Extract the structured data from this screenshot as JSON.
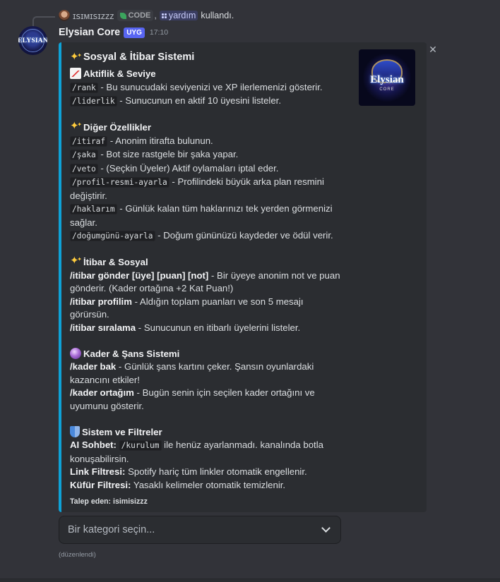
{
  "reply": {
    "user": "ɪꜱɪᴍɪꜱɪᴢᴢᴢ",
    "app_label": "CODE",
    "separator": ",",
    "command": "yardım",
    "action": "kullandı."
  },
  "message": {
    "bot_name": "Elysian Core",
    "bot_tag": "UYG",
    "time": "17:10",
    "avatar_text": "ELYSIAN"
  },
  "embed": {
    "accent_color": "#0ea2d7",
    "thumbnail": {
      "wordmark": "Elysian",
      "sub": "CORE"
    },
    "title": "Sosyal & İtibar Sistemi",
    "sections": {
      "s1": {
        "title": "Aktiflik & Seviye",
        "l1_cmd": "/rank",
        "l1_text": " - Bu sunucudaki seviyenizi ve XP ilerlemenizi gösterir.",
        "l2_cmd": "/liderlik",
        "l2_text": " - Sunucunun en aktif 10 üyesini listeler."
      },
      "s2": {
        "title": "Diğer Özellikler",
        "l1_cmd": "/itiraf",
        "l1_text": " - Anonim itirafta bulunun.",
        "l2_cmd": "/şaka",
        "l2_text": " - Bot size rastgele bir şaka yapar.",
        "l3_cmd": "/veto",
        "l3_text": " - (Seçkin Üyeler) Aktif oylamaları iptal eder.",
        "l4_cmd": "/profil-resmi-ayarla",
        "l4_text": " - Profilindeki büyük arka plan resmini",
        "l4_text2": "değiştirir.",
        "l5_cmd": "/haklarım",
        "l5_text": " - Günlük kalan tüm haklarınızı tek yerden görmenizi",
        "l5_text2": "sağlar.",
        "l6_cmd": "/doğumgünü-ayarla",
        "l6_text": " - Doğum gününüzü kaydeder ve ödül verir."
      },
      "s3": {
        "title": "İtibar & Sosyal",
        "l1_bold": "/itibar gönder [üye] [puan] [not]",
        "l1_text": " - Bir üyeye anonim not ve puan",
        "l1_text2": "gönderir. (Kader ortağına +2 Kat Puan!)",
        "l2_bold": "/itibar profilim",
        "l2_text": " - Aldığın toplam puanları ve son 5 mesajı",
        "l2_text2": "görürsün.",
        "l3_bold": "/itibar sıralama",
        "l3_text": " - Sunucunun en itibarlı üyelerini listeler."
      },
      "s4": {
        "title": "Kader & Şans Sistemi",
        "l1_bold": "/kader bak",
        "l1_text": " - Günlük şans kartını çeker. Şansın oyunlardaki",
        "l1_text2": "kazancını etkiler!",
        "l2_bold": "/kader ortağım",
        "l2_text": " - Bugün senin için seçilen kader ortağını ve",
        "l2_text2": "uyumunu gösterir."
      },
      "s5": {
        "title": "Sistem ve Filtreler",
        "l1_bold": "AI Sohbet:",
        "l1_cmd": "/kurulum",
        "l1_text": " ile henüz ayarlanmadı. kanalında botla",
        "l1_text2": "konuşabilirsin.",
        "l2_bold": "Link Filtresi:",
        "l2_text": " Spotify hariç tüm linkler otomatik engellenir.",
        "l3_bold": "Küfür Filtresi:",
        "l3_text": " Yasaklı kelimeler otomatik temizlenir."
      }
    },
    "footer": "Talep eden: isimisizzz"
  },
  "select": {
    "placeholder": "Bir kategori seçin..."
  },
  "edited": "(düzenlendi)"
}
